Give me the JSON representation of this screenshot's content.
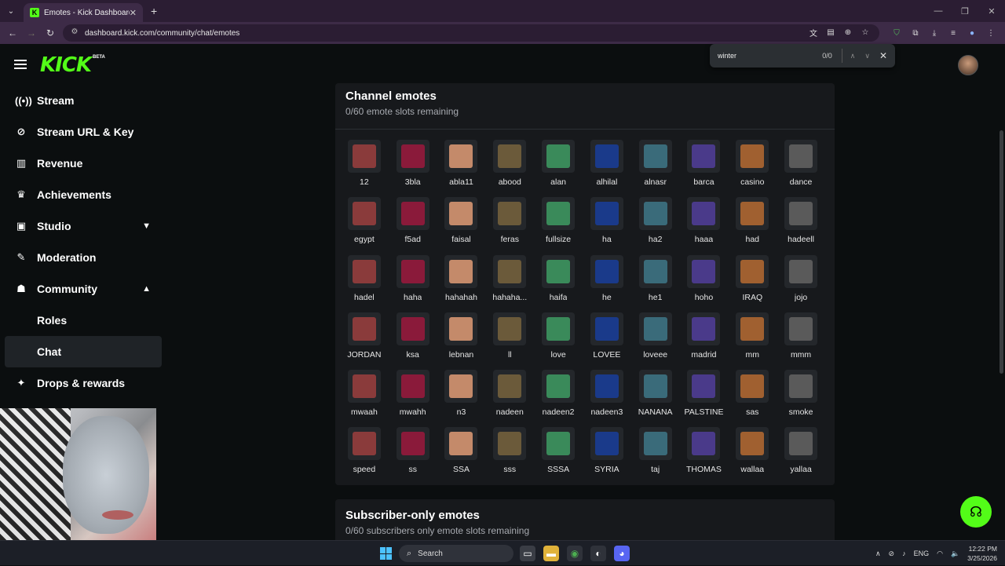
{
  "browser": {
    "tab_title": "Emotes - Kick Dashboard",
    "tab_favicon": "K",
    "url": "dashboard.kick.com/community/chat/emotes"
  },
  "find": {
    "query": "winter",
    "count": "0/0"
  },
  "brand": {
    "logo": "KICK",
    "badge": "BETA",
    "accent": "#53fc18"
  },
  "sidebar": {
    "items": [
      {
        "label": "Stream",
        "icon": "broadcast-icon"
      },
      {
        "label": "Stream URL & Key",
        "icon": "link-icon"
      },
      {
        "label": "Revenue",
        "icon": "chart-icon"
      },
      {
        "label": "Achievements",
        "icon": "trophy-icon"
      },
      {
        "label": "Studio",
        "icon": "studio-icon"
      },
      {
        "label": "Moderation",
        "icon": "wrench-icon"
      },
      {
        "label": "Community",
        "icon": "users-icon"
      },
      {
        "label": "Roles"
      },
      {
        "label": "Chat"
      },
      {
        "label": "Drops & rewards",
        "icon": "gift-icon"
      }
    ]
  },
  "channel_emotes": {
    "title": "Channel emotes",
    "subtitle": "0/60 emote slots remaining",
    "emotes": [
      "12",
      "3bla",
      "abla11",
      "abood",
      "alan",
      "alhilal",
      "alnasr",
      "barca",
      "casino",
      "dance",
      "egypt",
      "f5ad",
      "faisal",
      "feras",
      "fullsize",
      "ha",
      "ha2",
      "haaa",
      "had",
      "hadeell",
      "hadel",
      "haha",
      "hahahah",
      "hahaha...",
      "haifa",
      "he",
      "he1",
      "hoho",
      "IRAQ",
      "jojo",
      "JORDAN",
      "ksa",
      "lebnan",
      "ll",
      "love",
      "LOVEE",
      "loveee",
      "madrid",
      "mm",
      "mmm",
      "mwaah",
      "mwahh",
      "n3",
      "nadeen",
      "nadeen2",
      "nadeen3",
      "NANANA",
      "PALSTINE",
      "sas",
      "smoke",
      "speed",
      "ss",
      "SSA",
      "sss",
      "SSSA",
      "SYRIA",
      "taj",
      "THOMAS",
      "wallaa",
      "yallaa"
    ]
  },
  "subscriber_emotes": {
    "title": "Subscriber-only emotes",
    "subtitle": "0/60 subscribers only emote slots remaining"
  },
  "taskbar": {
    "search": "Search",
    "lang": "ENG",
    "time": "12:22 PM",
    "date": "3/25/2026"
  }
}
